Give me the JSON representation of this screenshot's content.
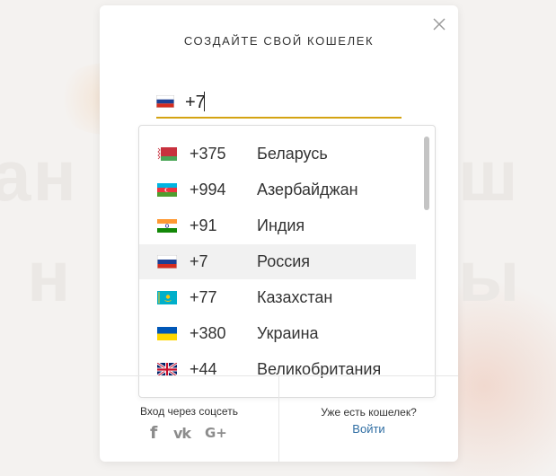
{
  "modal": {
    "title": "СОЗДАЙТЕ СВОЙ КОШЕЛЕК",
    "close_icon": "close-icon"
  },
  "phone": {
    "value": "+7",
    "selected_flag": "russia-flag-icon",
    "underline_color": "#d4a312"
  },
  "countries": [
    {
      "code": "+375",
      "name": "Беларусь",
      "flag": "belarus-flag-icon"
    },
    {
      "code": "+994",
      "name": "Азербайджан",
      "flag": "azerbaijan-flag-icon"
    },
    {
      "code": "+91",
      "name": "Индия",
      "flag": "india-flag-icon"
    },
    {
      "code": "+7",
      "name": "Россия",
      "flag": "russia-flag-icon",
      "selected": true
    },
    {
      "code": "+77",
      "name": "Казахстан",
      "flag": "kazakhstan-flag-icon"
    },
    {
      "code": "+380",
      "name": "Украина",
      "flag": "ukraine-flag-icon"
    },
    {
      "code": "+44",
      "name": "Великобритания",
      "flag": "uk-flag-icon"
    }
  ],
  "footer": {
    "social_label": "Вход через соцсеть",
    "social_icons": [
      "facebook-icon",
      "vk-icon",
      "google-plus-icon"
    ],
    "login_question": "Уже есть кошелек?",
    "login_link": "Войти"
  },
  "colors": {
    "accent": "#d4a312",
    "link": "#2f6ea3"
  }
}
